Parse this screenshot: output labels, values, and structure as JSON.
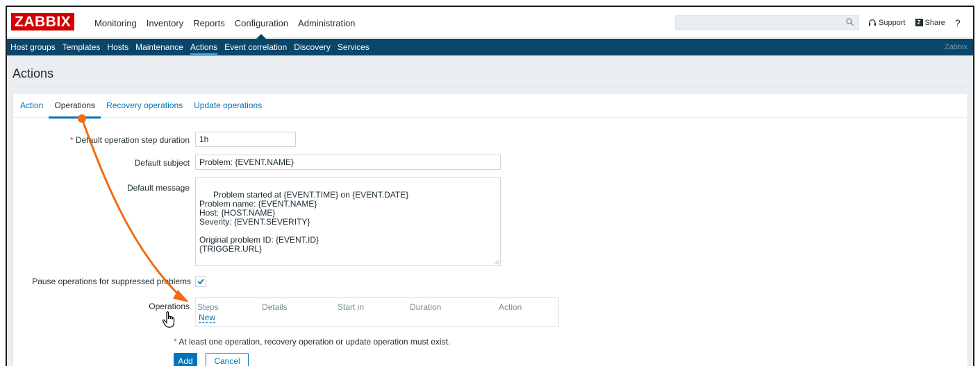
{
  "header": {
    "logo": "ZABBIX",
    "menu": [
      {
        "label": "Monitoring",
        "active": false
      },
      {
        "label": "Inventory",
        "active": false
      },
      {
        "label": "Reports",
        "active": false
      },
      {
        "label": "Configuration",
        "active": true
      },
      {
        "label": "Administration",
        "active": false
      }
    ],
    "search": {
      "value": "",
      "icon": "search-icon"
    },
    "support_label": "Support",
    "share_label": "Share",
    "share_badge": "Z",
    "help_label": "?",
    "user_icon": "user-icon",
    "logout_icon": "power-icon"
  },
  "subnav": {
    "items": [
      {
        "label": "Host groups",
        "active": false
      },
      {
        "label": "Templates",
        "active": false
      },
      {
        "label": "Hosts",
        "active": false
      },
      {
        "label": "Maintenance",
        "active": false
      },
      {
        "label": "Actions",
        "active": true
      },
      {
        "label": "Event correlation",
        "active": false
      },
      {
        "label": "Discovery",
        "active": false
      },
      {
        "label": "Services",
        "active": false
      }
    ],
    "brand": "Zabbix"
  },
  "page": {
    "title": "Actions"
  },
  "tabs": [
    {
      "label": "Action",
      "active": false
    },
    {
      "label": "Operations",
      "active": true
    },
    {
      "label": "Recovery operations",
      "active": false
    },
    {
      "label": "Update operations",
      "active": false
    }
  ],
  "form": {
    "step_duration": {
      "label": "Default operation step duration",
      "required_mark": "*",
      "value": "1h"
    },
    "subject": {
      "label": "Default subject",
      "value": "Problem: {EVENT.NAME}"
    },
    "message": {
      "label": "Default message",
      "value": "Problem started at {EVENT.TIME} on {EVENT.DATE}\nProblem name: {EVENT.NAME}\nHost: {HOST.NAME}\nSeverity: {EVENT.SEVERITY}\n\nOriginal problem ID: {EVENT.ID}\n{TRIGGER.URL}"
    },
    "pause": {
      "label": "Pause operations for suppressed problems",
      "checked": true
    },
    "operations": {
      "label": "Operations",
      "columns": [
        "Steps",
        "Details",
        "Start in",
        "Duration",
        "Action"
      ],
      "new_link": "New"
    },
    "note": {
      "required_mark": "*",
      "text": "At least one operation, recovery operation or update operation must exist."
    },
    "add_button": "Add",
    "cancel_button": "Cancel"
  },
  "colors": {
    "brand_red": "#d40000",
    "nav_blue": "#0a466a",
    "link_blue": "#0275b8",
    "annotation_orange": "#f26b0f"
  }
}
